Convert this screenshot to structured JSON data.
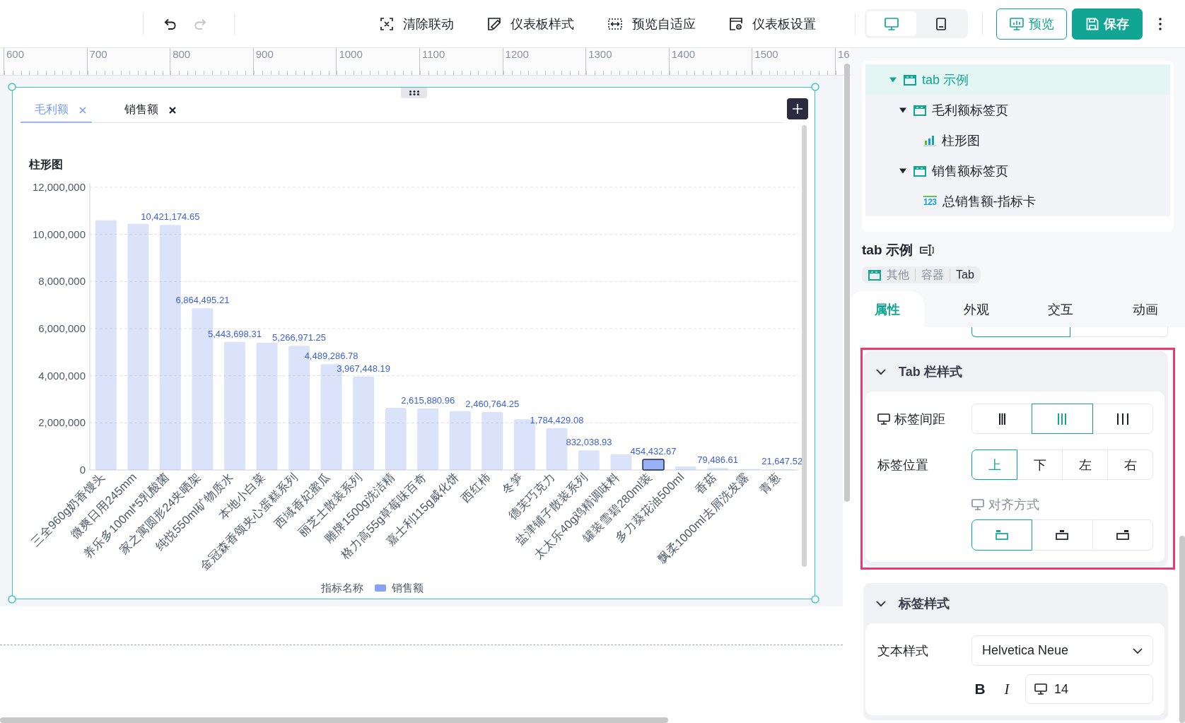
{
  "toolbar": {
    "history": [
      {
        "kind": "undo",
        "disabled": false
      },
      {
        "kind": "redo",
        "disabled": true
      }
    ],
    "actions": [
      {
        "kind": "clear-linkage",
        "label": "清除联动"
      },
      {
        "kind": "style",
        "label": "仪表板样式"
      },
      {
        "kind": "fit",
        "label": "预览自适应"
      },
      {
        "kind": "settings",
        "label": "仪表板设置"
      }
    ],
    "devices": [
      {
        "kind": "desktop",
        "selected": true
      },
      {
        "kind": "tablet",
        "selected": false
      }
    ],
    "preview_button": "预览",
    "save_button": "保存"
  },
  "ruler": {
    "labels": [
      "600",
      "700",
      "800",
      "900",
      "1000",
      "1100",
      "1200",
      "1300",
      "1400",
      "1500",
      "16"
    ]
  },
  "widget": {
    "selected": true,
    "tabs": [
      {
        "label": "毛利额",
        "selected": true
      },
      {
        "label": "销售额",
        "selected": false
      }
    ],
    "chart": {
      "title": "柱形图",
      "legend_title": "指标名称",
      "highlighted": [
        false,
        false,
        false,
        false,
        false,
        false,
        false,
        false,
        false,
        false,
        false,
        false,
        false,
        false,
        false,
        false,
        false,
        true,
        false,
        false,
        false,
        false
      ],
      "chart_data": {
        "type": "bar",
        "categories": [
          "三全960g奶香馒头",
          "微爽日用245mm",
          "养乐多100ml*5乳酸菌",
          "家之寓圆形24夹晒架",
          "纯悦550ml矿物质水",
          "本地小白菜",
          "金冠森香颂夹心蛋糕系列",
          "西域香妃蜜瓜",
          "丽芝士散装系列",
          "雕牌1500g洗洁精",
          "格力高55g草莓味百奇",
          "嘉士利115g威化饼",
          "西红柿",
          "冬笋",
          "德芙巧克力",
          "盐津铺子散装系列",
          "太太乐40g鸡精调味料",
          "罐装雪碧280ml装",
          "多力葵花油500ml",
          "香菇",
          "飘柔1000ml去屑洗发露",
          "青葱"
        ],
        "series": [
          {
            "name": "销售额",
            "color": "#87a3f3",
            "values": [
              10600000,
              10450000,
              10400000,
              6860000,
              5440000,
              5400000,
              5270000,
              4490000,
              3970000,
              2640000,
              2620000,
              2500000,
              2460000,
              2150000,
              1780000,
              830000,
              670000,
              450000,
              150000,
              80000,
              40000,
              20000
            ]
          }
        ],
        "ylim": [
          0,
          12000000
        ],
        "yticks": [
          {
            "value": 0,
            "label": "0"
          },
          {
            "value": 2000000,
            "label": "2,000,000"
          },
          {
            "value": 4000000,
            "label": "4,000,000"
          },
          {
            "value": 6000000,
            "label": "6,000,000"
          },
          {
            "value": 8000000,
            "label": "8,000,000"
          },
          {
            "value": 10000000,
            "label": "10,000,000"
          },
          {
            "value": 12000000,
            "label": "12,000,000"
          }
        ],
        "grid": true,
        "value_labels": [
          null,
          null,
          "10,421,174.65",
          "6,864,495.21",
          "5,443,698.31",
          null,
          "5,266,971.25",
          "4,489,286.78",
          "3,967,448.19",
          null,
          "2,615,880.96",
          null,
          "2,460,764.25",
          null,
          "1,784,429.08",
          "832,038.93",
          null,
          "454,432.67",
          null,
          "79,486.61",
          null,
          "21,647.52"
        ]
      }
    }
  },
  "panel": {
    "tree": [
      {
        "label": "tab 示例",
        "kind": "tab-container",
        "expanded": true,
        "selected": true,
        "children": [
          {
            "label": "毛利额标签页",
            "kind": "tab-page",
            "expanded": true,
            "selected": false,
            "children": [
              {
                "label": "柱形图",
                "kind": "bar-chart",
                "selected": false
              }
            ]
          },
          {
            "label": "销售额标签页",
            "kind": "tab-page",
            "expanded": true,
            "selected": false,
            "children": [
              {
                "label": "总销售额-指标卡",
                "kind": "metric-card",
                "icon_label": "123",
                "selected": false
              }
            ]
          }
        ]
      }
    ],
    "title": "tab 示例",
    "breadcrumb": [
      "其他",
      "容器",
      "Tab"
    ],
    "tabs": [
      {
        "label": "属性",
        "selected": true
      },
      {
        "label": "外观",
        "selected": false
      },
      {
        "label": "交互",
        "selected": false
      },
      {
        "label": "动画",
        "selected": false
      }
    ],
    "partial_segments": [
      {
        "selected": true
      },
      {
        "selected": false
      }
    ],
    "sections": [
      {
        "title": "Tab 栏样式",
        "expanded": true,
        "highlighted": true,
        "rows": [
          {
            "kind": "segmented",
            "label": "标签间距",
            "responsive": true,
            "options": [
              {
                "kind": "narrow",
                "selected": false
              },
              {
                "kind": "medium",
                "selected": true
              },
              {
                "kind": "wide",
                "selected": false
              }
            ]
          },
          {
            "kind": "segmented",
            "label": "标签位置",
            "responsive": false,
            "options": [
              {
                "label": "上",
                "selected": true
              },
              {
                "label": "下",
                "selected": false
              },
              {
                "label": "左",
                "selected": false
              },
              {
                "label": "右",
                "selected": false
              }
            ]
          },
          {
            "kind": "stacked",
            "label": "对齐方式",
            "responsive": true,
            "options": [
              {
                "kind": "align-left",
                "selected": true
              },
              {
                "kind": "align-center",
                "selected": false
              },
              {
                "kind": "align-right",
                "selected": false
              }
            ]
          }
        ]
      },
      {
        "title": "标签样式",
        "expanded": true,
        "highlighted": false,
        "rows": [
          {
            "kind": "select",
            "label": "文本样式",
            "value": "Helvetica Neue"
          },
          {
            "kind": "font-style",
            "bold": "B",
            "italic": "I",
            "size": "14",
            "responsive": true
          }
        ]
      }
    ]
  }
}
